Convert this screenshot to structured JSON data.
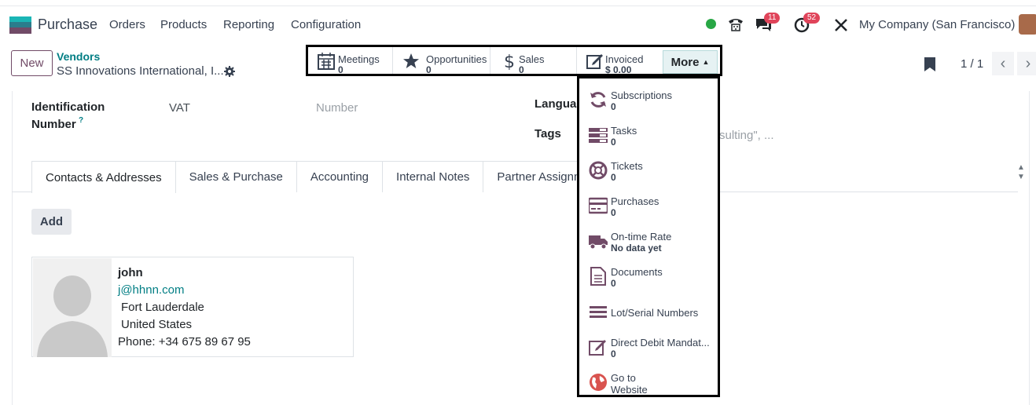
{
  "navbar": {
    "app_name": "Purchase",
    "menus": [
      "Orders",
      "Products",
      "Reporting",
      "Configuration"
    ],
    "messages_badge": "11",
    "activities_badge": "52",
    "company": "My Company (San Francisco)",
    "status_color": "#28a745"
  },
  "control_panel": {
    "new_label": "New",
    "breadcrumb_parent": "Vendors",
    "breadcrumb_current": "SS Innovations International, I...",
    "pager": "1 / 1"
  },
  "stat_buttons": [
    {
      "icon": "calendar-icon",
      "label": "Meetings",
      "value": "0"
    },
    {
      "icon": "star-icon",
      "label": "Opportunities",
      "value": "0"
    },
    {
      "icon": "dollar-icon",
      "label": "Sales",
      "value": "0"
    },
    {
      "icon": "edit-icon",
      "label": "Invoiced",
      "value": "$ 0.00"
    }
  ],
  "more_label": "More",
  "dropdown": [
    {
      "icon": "refresh-icon",
      "label": "Subscriptions",
      "value": "0"
    },
    {
      "icon": "tasks-icon",
      "label": "Tasks",
      "value": "0"
    },
    {
      "icon": "lifebuoy-icon",
      "label": "Tickets",
      "value": "0"
    },
    {
      "icon": "credit-card-icon",
      "label": "Purchases",
      "value": "0"
    },
    {
      "icon": "truck-icon",
      "label": "On-time Rate",
      "value": "No data yet"
    },
    {
      "icon": "document-icon",
      "label": "Documents",
      "value": "0"
    },
    {
      "icon": "list-icon",
      "label": "Lot/Serial Numbers",
      "value": ""
    },
    {
      "icon": "edit-icon",
      "label": "Direct Debit Mandat...",
      "value": "0"
    },
    {
      "icon": "globe-icon",
      "label": "Go to",
      "value": "Website"
    }
  ],
  "form": {
    "identification_label_1": "Identification",
    "identification_label_2": "Number",
    "help_mark": "?",
    "vat_placeholder": "VAT",
    "number_placeholder": "Number",
    "language_label": "Languag",
    "tags_label": "Tags",
    "tags_placeholder": "sulting\", ..."
  },
  "tabs": [
    "Contacts & Addresses",
    "Sales & Purchase",
    "Accounting",
    "Internal Notes",
    "Partner Assignment"
  ],
  "add_label": "Add",
  "contact": {
    "name": "john",
    "email": "j@hhnn.com",
    "city": "Fort Lauderdale",
    "country": "United States",
    "phone": "Phone: +34 675 89 67 95"
  }
}
